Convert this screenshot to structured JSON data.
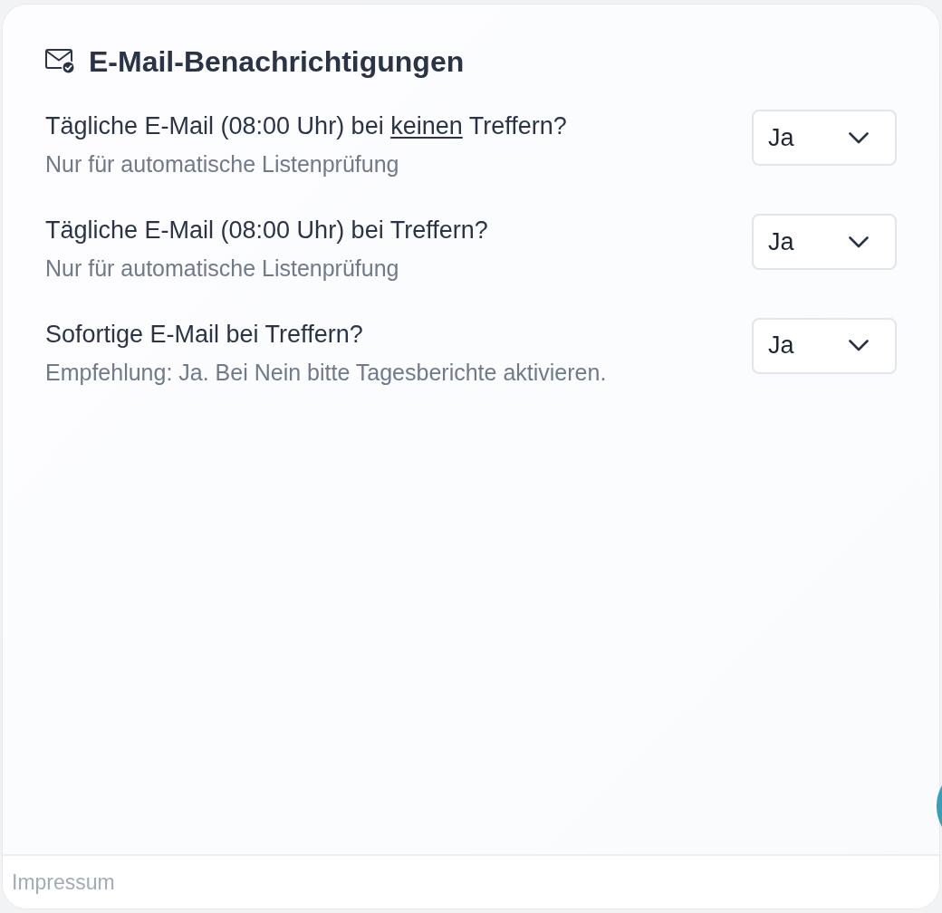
{
  "header": {
    "title": "E-Mail-Benachrichtigungen"
  },
  "settings": [
    {
      "label_parts": [
        {
          "text": "Tägliche E-Mail (08:00 Uhr) bei ",
          "underlined": false
        },
        {
          "text": "keinen",
          "underlined": true
        },
        {
          "text": " Treffern?",
          "underlined": false
        }
      ],
      "hint": "Nur für automatische Listenprüfung",
      "value": "Ja"
    },
    {
      "label_parts": [
        {
          "text": "Tägliche E-Mail (08:00 Uhr) bei Treffern?",
          "underlined": false
        }
      ],
      "hint": "Nur für automatische Listenprüfung",
      "value": "Ja"
    },
    {
      "label_parts": [
        {
          "text": "Sofortige E-Mail bei Treffern?",
          "underlined": false
        }
      ],
      "hint": "Empfehlung: Ja. Bei Nein bitte Tagesberichte aktivieren.",
      "value": "Ja"
    }
  ],
  "footer": {
    "link": "Impressum"
  }
}
